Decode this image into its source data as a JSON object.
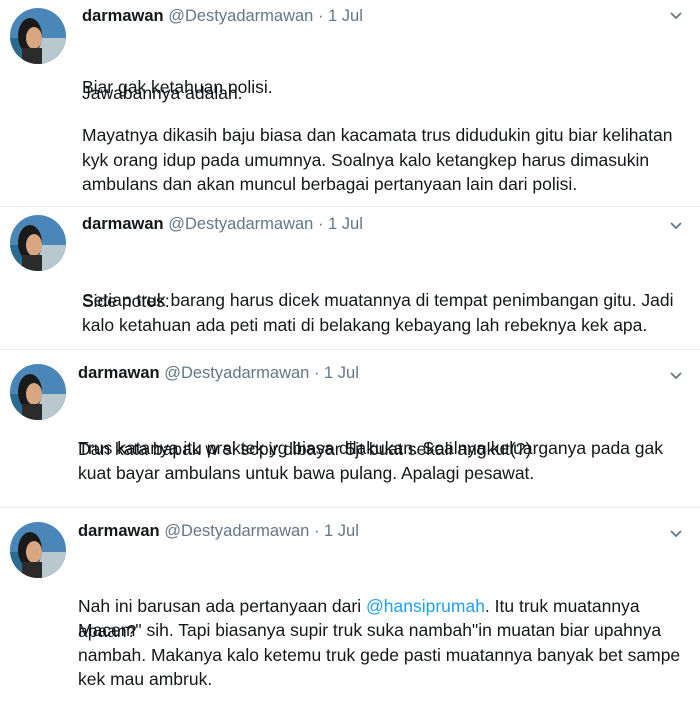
{
  "tweets": [
    {
      "name": "darmawan",
      "handle": "@Destyadarmawan",
      "dot": "·",
      "time": "1 Jul",
      "paragraphs": [
        "Jawabannya adalah.",
        "Biar gak ketahuan polisi.",
        "Mayatnya dikasih baju biasa dan kacamata trus didudukin gitu biar kelihatan kyk orang idup pada umumnya. Soalnya kalo ketangkep harus dimasukin ambulans dan akan muncul berbagai pertanyaan lain dari polisi."
      ]
    },
    {
      "name": "darmawan",
      "handle": "@Destyadarmawan",
      "dot": "·",
      "time": "1 Jul",
      "paragraphs": [
        "Side notes:",
        "Setiap truk barang harus dicek muatannya di tempat penimbangan gitu. Jadi kalo ketahuan ada peti mati di belakang kebayang lah rebeknya kek apa."
      ]
    },
    {
      "name": "darmawan",
      "handle": "@Destyadarmawan",
      "dot": "·",
      "time": "1 Jul",
      "paragraphs": [
        "Dan kata bapak w si sopir dibayar 5jt buat sekali angkut(?)",
        "Trus katanya itu praktek yg biasa dilakukan. Soalnya keluarganya pada gak kuat bayar ambulans untuk bawa pulang. Apalagi pesawat."
      ]
    },
    {
      "name": "darmawan",
      "handle": "@Destyadarmawan",
      "dot": "·",
      "time": "1 Jul",
      "p1_before": "Nah ini barusan ada pertanyaan dari ",
      "p1_mention": "@hansiprumah",
      "p1_after": ". Itu truk muatannya apaan?",
      "paragraphs": [
        "Macem\" sih. Tapi biasanya supir truk suka nambah\"in muatan biar upahnya nambah. Makanya kalo ketemu truk gede pasti muatannya banyak bet sampe kek mau ambruk."
      ]
    }
  ],
  "icons": {
    "avatar": "avatar",
    "menu": "chevron-down-icon"
  },
  "colors": {
    "name": "#14171a",
    "meta": "#657786",
    "mention": "#1da1f2",
    "divider": "#e6ecf0"
  }
}
